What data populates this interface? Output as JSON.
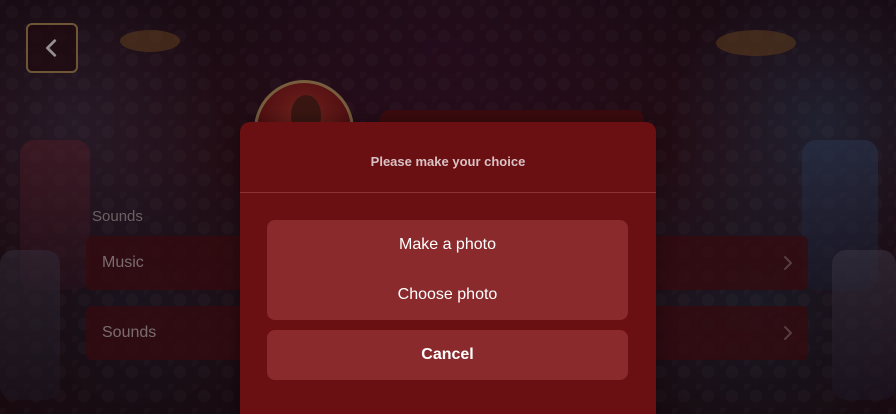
{
  "header": {
    "back_icon": "chevron-left-icon"
  },
  "settings": {
    "section_label": "Sounds",
    "rows": [
      {
        "label": "Music",
        "icon": "chevron-right-icon"
      },
      {
        "label": "Sounds",
        "icon": "chevron-right-icon"
      }
    ]
  },
  "modal": {
    "title": "Please make your choice",
    "options": [
      {
        "label": "Make a photo"
      },
      {
        "label": "Choose photo"
      }
    ],
    "cancel_label": "Cancel"
  },
  "colors": {
    "accent_gold": "#c8a668",
    "modal_bg": "#6a1013",
    "button_bg": "#8a2a2c"
  }
}
